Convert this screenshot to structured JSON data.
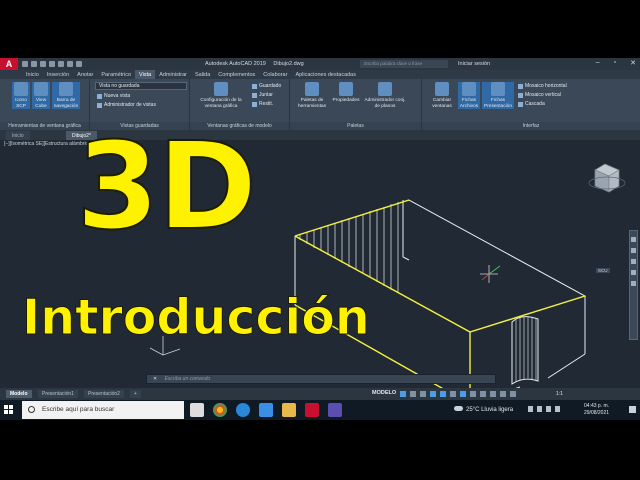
{
  "titlebar": {
    "app_title": "Autodesk AutoCAD 2019",
    "file_name": "Dibujo2.dwg",
    "search_placeholder": "Escriba palabra clave o frase",
    "signin": "Iniciar sesión"
  },
  "ribbon_tabs": [
    {
      "label": "Inicio"
    },
    {
      "label": "Inserción"
    },
    {
      "label": "Anotar"
    },
    {
      "label": "Paramétrico"
    },
    {
      "label": "Vista",
      "active": true
    },
    {
      "label": "Administrar"
    },
    {
      "label": "Salida"
    },
    {
      "label": "Complementos"
    },
    {
      "label": "Colaborar"
    },
    {
      "label": "Aplicaciones destacadas"
    }
  ],
  "ribbon": {
    "tools": {
      "ucs_icon": "Icono SCP",
      "view_cube": "View Cube",
      "nav_bar": "Barra de navegación",
      "label": "Herramientas de ventana gráfica"
    },
    "named_views": {
      "current_view": "Vista no guardada",
      "new_view": "Nueva vista",
      "view_manager": "Administrador de vistas",
      "label": "Vistas guardadas"
    },
    "model_viewports": {
      "config": "Configuración de la ventana gráfica",
      "named": "Guardado",
      "join": "Juntar",
      "restore": "Restit.",
      "label": "Ventanas gráficas de modelo"
    },
    "palettes": {
      "tool_palettes": "Paletas de herramientas",
      "properties": "Propiedades",
      "sheet_set": "Administrador conj. de planos",
      "label": "Paletas"
    },
    "interface": {
      "switch_windows": "Cambiar ventanas",
      "file_tabs": "Fichas Archivos",
      "layout_tabs": "Fichas Presentación",
      "tile_h": "Mosaico horizontal",
      "tile_v": "Mosaico vertical",
      "cascade": "Cascada",
      "label": "Interfaz"
    }
  },
  "doc_tabs": [
    {
      "label": "Inicio"
    },
    {
      "label": "Dibujo2*",
      "active": true
    }
  ],
  "viewport": {
    "label": "[−][Isométrica SE][Estructura alámbrica]",
    "viewcube_label": "SCU"
  },
  "command_line": {
    "prompt": "Escriba un comando"
  },
  "layout_tabs": [
    {
      "label": "Modelo",
      "active": true
    },
    {
      "label": "Presentación1"
    },
    {
      "label": "Presentación2"
    },
    {
      "label": "+"
    }
  ],
  "status": {
    "mode": "MODELO",
    "scale": "1:1"
  },
  "taskbar": {
    "search_placeholder": "Escribe aquí para buscar",
    "weather": "25°C  Lluvia ligera",
    "time": "04:43 p. m.",
    "date": "29/08/2021"
  },
  "overlay": {
    "title": "3D",
    "subtitle": "Introducción"
  },
  "colors": {
    "accent": "#fff200",
    "autocad_red": "#c8102e",
    "viewport_bg": "#212a34"
  }
}
